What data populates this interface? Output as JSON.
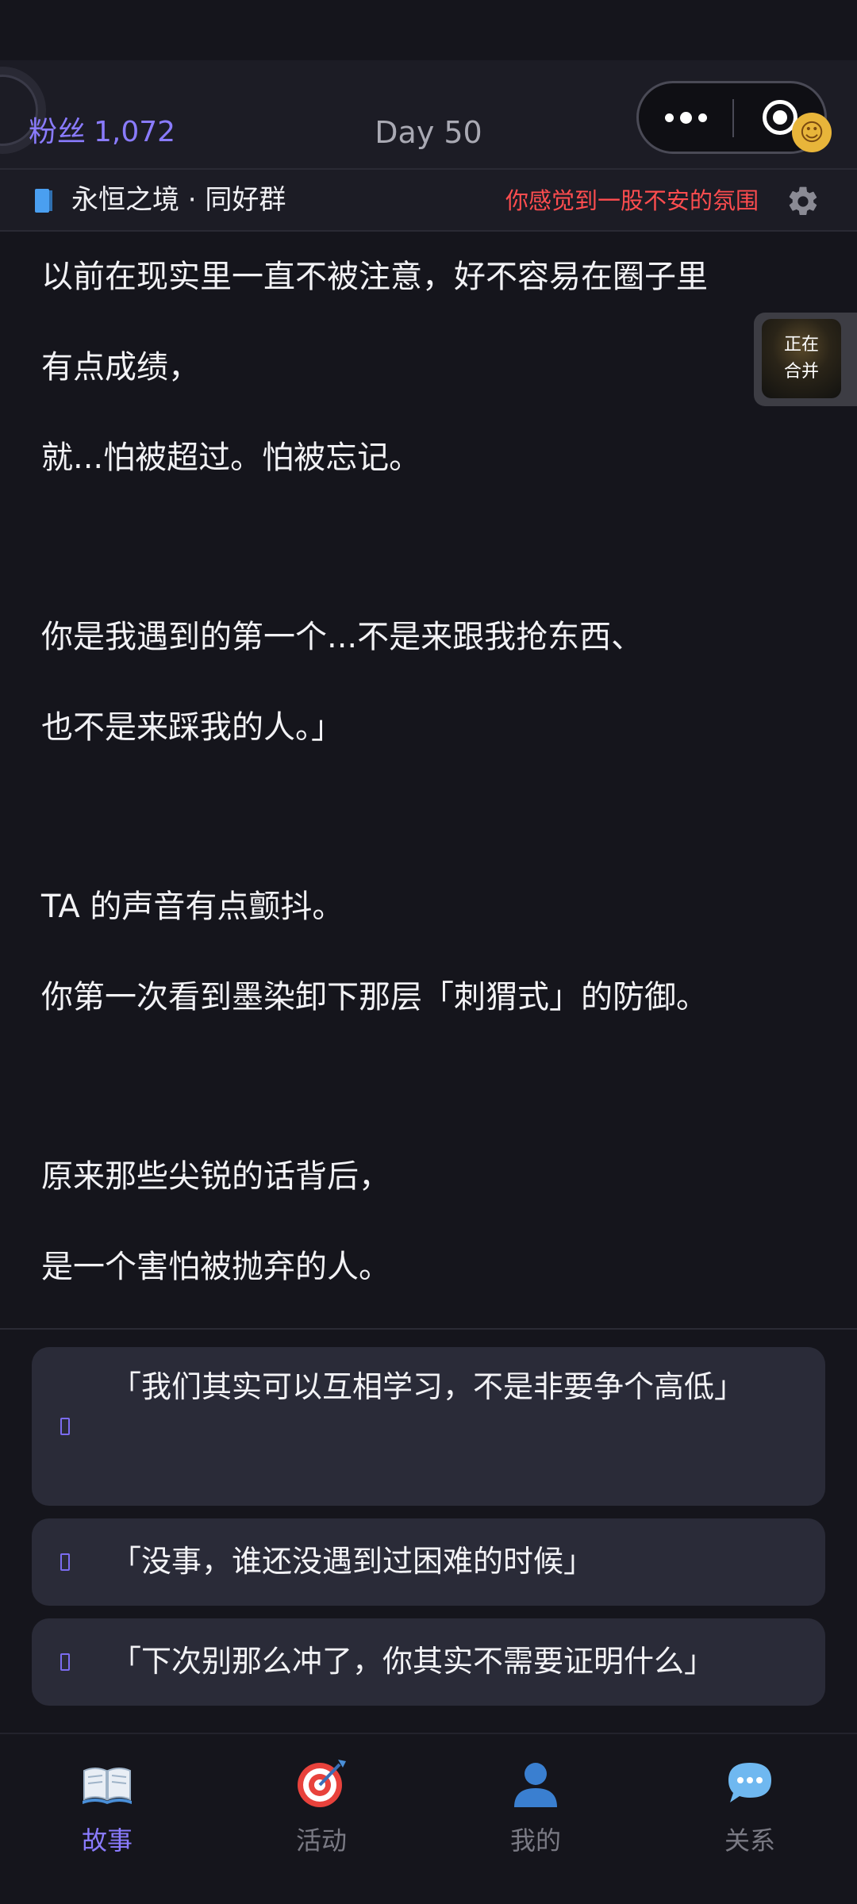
{
  "header": {
    "fans_label": "粉丝",
    "fans_count": "1,072",
    "day": "Day 50"
  },
  "group_bar": {
    "group_name": "永恒之境 · 同好群",
    "mood_text": "你感觉到一股不安的氛围"
  },
  "merge_badge": {
    "line1": "正在",
    "line2": "合并"
  },
  "story": {
    "lines": [
      "以前在现实里一直不被注意，好不容易在圈子里",
      "有点成绩，",
      "就...怕被超过。怕被忘记。",
      "",
      "你是我遇到的第一个...不是来跟我抢东西、",
      "也不是来踩我的人。」",
      "",
      "TA 的声音有点颤抖。",
      "你第一次看到墨染卸下那层「刺猬式」的防御。",
      "",
      "原来那些尖锐的话背后，",
      "是一个害怕被抛弃的人。"
    ]
  },
  "choices": [
    {
      "text": "「我们其实可以互相学习，不是非要争个高低」"
    },
    {
      "text": "「没事，谁还没遇到过困难的时候」"
    },
    {
      "text": "「下次别那么冲了，你其实不需要证明什么」"
    }
  ],
  "tabs": [
    {
      "label": "故事",
      "icon": "open-book-icon",
      "active": true
    },
    {
      "label": "活动",
      "icon": "target-dart-icon",
      "active": false
    },
    {
      "label": "我的",
      "icon": "person-icon",
      "active": false
    },
    {
      "label": "关系",
      "icon": "speech-bubble-icon",
      "active": false
    }
  ],
  "colors": {
    "background": "#15151c",
    "accent": "#8a7bff",
    "warning": "#ff4d4f",
    "choice_bg": "#2a2b38"
  }
}
